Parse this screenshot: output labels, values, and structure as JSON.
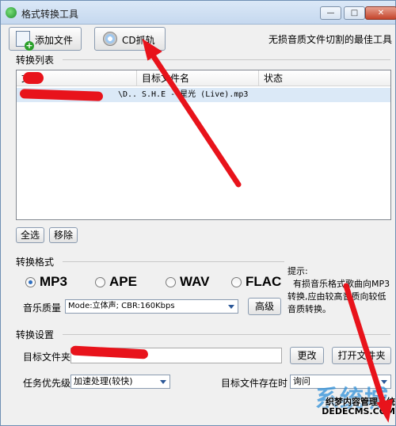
{
  "window": {
    "title": "格式转换工具",
    "controls": {
      "minimize": "—",
      "maximize": "□",
      "close": "✕"
    }
  },
  "toolbar": {
    "add_file_label": "添加文件",
    "cd_rip_label": "CD抓轨",
    "slogan": "无损音质文件切割的最佳工具"
  },
  "convert_list": {
    "group_label": "转换列表",
    "columns": [
      "文件",
      "目标文件名",
      "状态"
    ],
    "rows": [
      {
        "file": "\\D..",
        "target": "S.H.E - 星光 (Live).mp3",
        "status": ""
      }
    ],
    "select_all_label": "全选",
    "remove_label": "移除"
  },
  "format": {
    "group_label": "转换格式",
    "options": [
      "MP3",
      "APE",
      "WAV",
      "FLAC"
    ],
    "selected": "MP3",
    "quality_label": "音乐质量",
    "quality_value": "Mode:立体声; CBR:160Kbps",
    "advanced_label": "高级",
    "tip": "提示:\n  有损音乐格式歌曲向MP3转换,应由较高音质向较低音质转换。"
  },
  "settings": {
    "group_label": "转换设置",
    "target_folder_label": "目标文件夹",
    "change_label": "更改",
    "open_folder_label": "打开文件夹",
    "priority_label": "任务优先级",
    "priority_value": "加速处理(较快)",
    "exists_label": "目标文件存在时",
    "exists_value": "询问"
  },
  "watermark": {
    "logo": "系统城",
    "line1": "织梦内容管理系统",
    "line2": "DEDECMS.COM"
  },
  "colors": {
    "annotation_red": "#e8131b",
    "selection_blue": "#dbe9f7",
    "title_gradient": "#c5d8ef"
  }
}
